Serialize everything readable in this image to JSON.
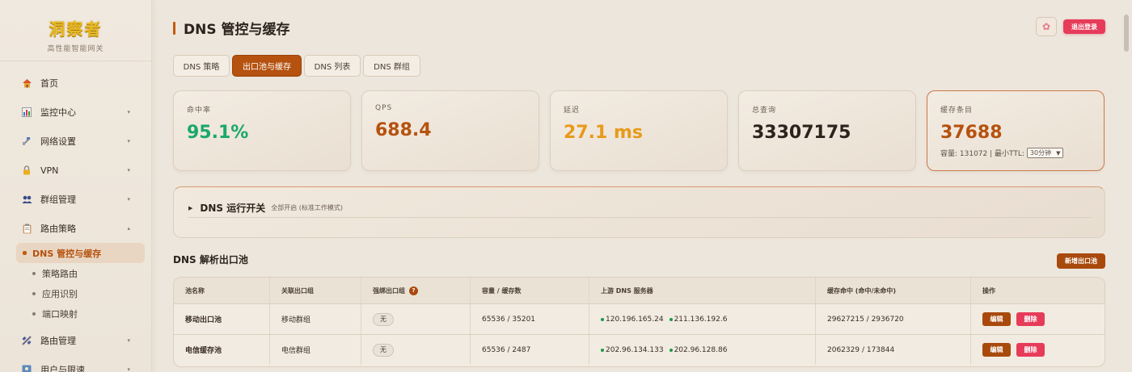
{
  "brand": {
    "logo": "洞察者",
    "subtitle": "高性能智能网关"
  },
  "sidebar": {
    "items": [
      {
        "label": "首页",
        "icon": "home-icon",
        "expandable": false
      },
      {
        "label": "监控中心",
        "icon": "chart-icon",
        "expandable": true
      },
      {
        "label": "网络设置",
        "icon": "satellite-icon",
        "expandable": true
      },
      {
        "label": "VPN",
        "icon": "lock-icon",
        "expandable": true
      },
      {
        "label": "群组管理",
        "icon": "group-icon",
        "expandable": true
      },
      {
        "label": "路由策略",
        "icon": "clipboard-icon",
        "expandable": true
      }
    ],
    "subitems": [
      {
        "label": "DNS 管控与缓存",
        "active": true
      },
      {
        "label": "策略路由",
        "active": false
      },
      {
        "label": "应用识别",
        "active": false
      },
      {
        "label": "端口映射",
        "active": false
      }
    ],
    "items_after": [
      {
        "label": "路由管理",
        "icon": "satellite-dish-icon",
        "expandable": true
      },
      {
        "label": "用户与限速",
        "icon": "user-icon",
        "expandable": true
      }
    ]
  },
  "header": {
    "title": "DNS 管控与缓存",
    "logout_label": "退出登录",
    "theme_icon": "flower-icon"
  },
  "tabs": [
    {
      "label": "DNS 策略",
      "active": false
    },
    {
      "label": "出口池与缓存",
      "active": true
    },
    {
      "label": "DNS 列表",
      "active": false
    },
    {
      "label": "DNS 群组",
      "active": false
    }
  ],
  "stats": {
    "hit_rate": {
      "label": "命中率",
      "value": "95.1%",
      "color": "#1aa86a"
    },
    "qps": {
      "label": "QPS",
      "value": "688.4",
      "color": "#b5520f"
    },
    "latency": {
      "label": "延迟",
      "value": "27.1 ms",
      "color": "#e89a1a"
    },
    "total": {
      "label": "总查询",
      "value": "33307175",
      "color": "#2c231d"
    },
    "cache": {
      "label": "缓存条目",
      "value": "37688",
      "color": "#b5520f",
      "capacity_text": "容量: 131072 | 最小TTL:",
      "ttl_selected": "30分钟"
    }
  },
  "dns_toggle": {
    "title": "DNS 运行开关",
    "subtitle": "全部开启 (标准工作模式)"
  },
  "pool": {
    "section_title": "DNS 解析出口池",
    "add_label": "新增出口池",
    "columns": [
      "池名称",
      "关联出口组",
      "强绑出口组",
      "容量 / 缓存数",
      "上游 DNS 服务器",
      "缓存命中 (命中/未命中)",
      "操作"
    ],
    "rows": [
      {
        "name": "移动出口池",
        "group": "移动群组",
        "bind": "无",
        "capacity": "65536 / 35201",
        "servers": [
          "120.196.165.24",
          "211.136.192.6"
        ],
        "hits": "29627215 / 2936720"
      },
      {
        "name": "电信缓存池",
        "group": "电信群组",
        "bind": "无",
        "capacity": "65536 / 2487",
        "servers": [
          "202.96.134.133",
          "202.96.128.86"
        ],
        "hits": "2062329 / 173844"
      }
    ],
    "edit_label": "编辑",
    "delete_label": "删除"
  }
}
